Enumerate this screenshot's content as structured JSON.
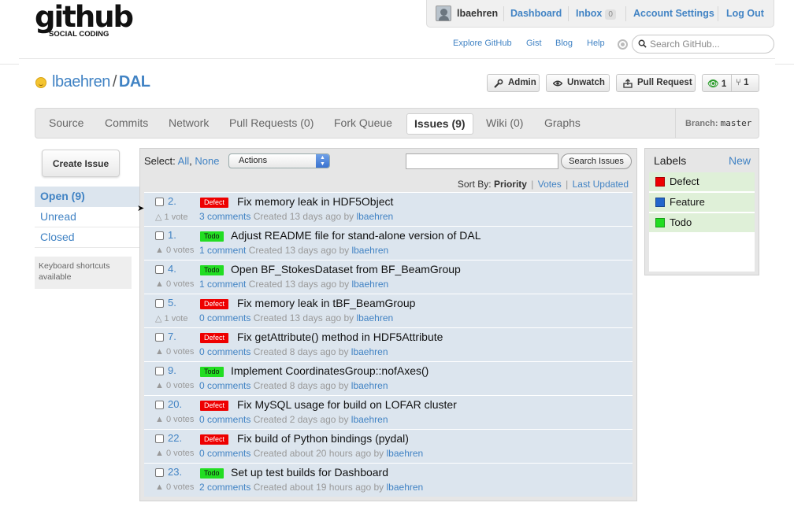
{
  "header": {
    "logo_word": "github",
    "logo_sub": "SOCIAL CODING",
    "user": "lbaehren",
    "nav": {
      "dashboard": "Dashboard",
      "inbox": "Inbox",
      "inbox_count": "0",
      "settings": "Account Settings",
      "logout": "Log Out"
    },
    "links": {
      "explore": "Explore GitHub",
      "gist": "Gist",
      "blog": "Blog",
      "help": "Help"
    },
    "search_placeholder": "Search GitHub..."
  },
  "repo": {
    "owner": "lbaehren",
    "slash": "/",
    "name": "DAL",
    "buttons": {
      "admin": "Admin",
      "unwatch": "Unwatch",
      "pull_request": "Pull Request"
    },
    "watchers": "1",
    "forks": "1"
  },
  "tabs": [
    {
      "label": "Source"
    },
    {
      "label": "Commits"
    },
    {
      "label": "Network"
    },
    {
      "label": "Pull Requests (0)"
    },
    {
      "label": "Fork Queue"
    },
    {
      "label": "Issues (9)"
    },
    {
      "label": "Wiki (0)"
    },
    {
      "label": "Graphs"
    }
  ],
  "active_tab": "Issues (9)",
  "branch": {
    "label": "Branch:",
    "value": "master"
  },
  "sidebar": {
    "create": "Create Issue",
    "filters": [
      {
        "label": "Open (9)"
      },
      {
        "label": "Unread"
      },
      {
        "label": "Closed"
      }
    ],
    "keyboard": "Keyboard shortcuts available"
  },
  "toolbar": {
    "select_label": "Select:",
    "all": "All",
    "comma": ",",
    "none": "None",
    "actions": "Actions",
    "search_button": "Search Issues",
    "sort_label": "Sort By:",
    "sort_priority": "Priority",
    "sort_votes": "Votes",
    "sort_updated": "Last Updated",
    "pipe": "|"
  },
  "issues": [
    {
      "num": "2.",
      "label": "Defect",
      "title": "Fix memory leak in HDF5Object",
      "votes": "△ 1 vote",
      "comments": "3 comments",
      "created": "Created 13 days ago by",
      "author": "lbaehren"
    },
    {
      "num": "1.",
      "label": "Todo",
      "title": "Adjust README file for stand-alone version of DAL",
      "votes": "▲ 0 votes",
      "comments": "1 comment",
      "created": "Created 13 days ago by",
      "author": "lbaehren"
    },
    {
      "num": "4.",
      "label": "Todo",
      "title": "Open BF_StokesDataset from BF_BeamGroup",
      "votes": "▲ 0 votes",
      "comments": "1 comment",
      "created": "Created 13 days ago by",
      "author": "lbaehren"
    },
    {
      "num": "5.",
      "label": "Defect",
      "title": "Fix memory leak in tBF_BeamGroup",
      "votes": "△ 1 vote",
      "comments": "0 comments",
      "created": "Created 13 days ago by",
      "author": "lbaehren"
    },
    {
      "num": "7.",
      "label": "Defect",
      "title": "Fix getAttribute() method in HDF5Attribute",
      "votes": "▲ 0 votes",
      "comments": "0 comments",
      "created": "Created 8 days ago by",
      "author": "lbaehren"
    },
    {
      "num": "9.",
      "label": "Todo",
      "title": "Implement CoordinatesGroup::nofAxes()",
      "votes": "▲ 0 votes",
      "comments": "0 comments",
      "created": "Created 8 days ago by",
      "author": "lbaehren"
    },
    {
      "num": "20.",
      "label": "Defect",
      "title": "Fix MySQL usage for build on LOFAR cluster",
      "votes": "▲ 0 votes",
      "comments": "0 comments",
      "created": "Created 2 days ago by",
      "author": "lbaehren"
    },
    {
      "num": "22.",
      "label": "Defect",
      "title": "Fix build of Python bindings (pydal)",
      "votes": "▲ 0 votes",
      "comments": "0 comments",
      "created": "Created about 20 hours ago by",
      "author": "lbaehren"
    },
    {
      "num": "23.",
      "label": "Todo",
      "title": "Set up test builds for Dashboard",
      "votes": "▲ 0 votes",
      "comments": "2 comments",
      "created": "Created about 19 hours ago by",
      "author": "lbaehren"
    }
  ],
  "labels": {
    "heading": "Labels",
    "new": "New",
    "items": [
      {
        "name": "Defect",
        "color": "#ee0000"
      },
      {
        "name": "Feature",
        "color": "#2266cc"
      },
      {
        "name": "Todo",
        "color": "#22dd22"
      }
    ]
  },
  "colors": {
    "link": "#4183c4",
    "defect": "#ee0000",
    "todo": "#22dd22",
    "row_bg": "#dce5ee"
  }
}
